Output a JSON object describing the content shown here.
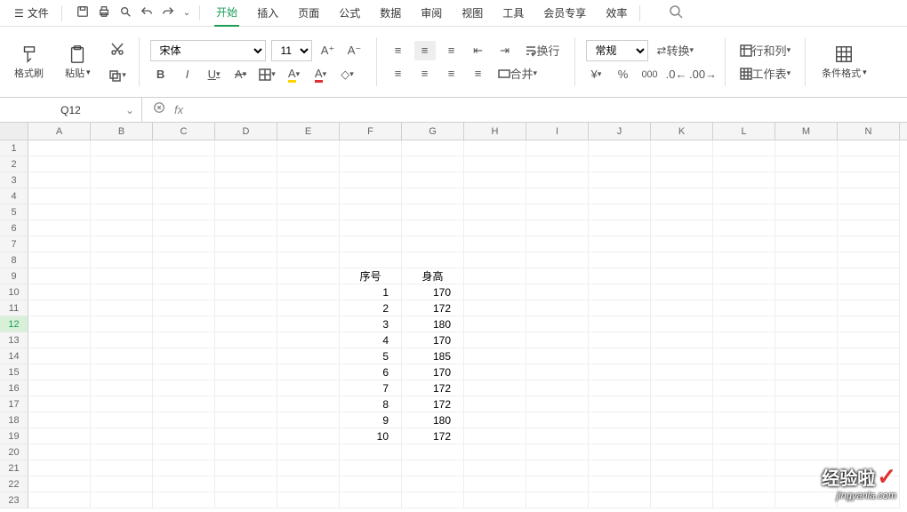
{
  "menu": {
    "file": "文件",
    "tabs": [
      "开始",
      "插入",
      "页面",
      "公式",
      "数据",
      "审阅",
      "视图",
      "工具",
      "会员专享",
      "效率"
    ],
    "active_tab": 0
  },
  "toolbar": {
    "brush": "格式刷",
    "paste": "粘贴",
    "font_name": "宋体",
    "font_size": "11",
    "wrap": "换行",
    "merge": "合并",
    "num_format": "常规",
    "convert": "转换",
    "rowcol": "行和列",
    "worksheet": "工作表",
    "cond_format": "条件格式"
  },
  "cell_ref": "Q12",
  "columns": [
    "A",
    "B",
    "C",
    "D",
    "E",
    "F",
    "G",
    "H",
    "I",
    "J",
    "K",
    "L",
    "M",
    "N"
  ],
  "row_count": 23,
  "selected_row": 12,
  "data": {
    "F9": "序号",
    "G9": "身高",
    "F10": "1",
    "G10": "170",
    "F11": "2",
    "G11": "172",
    "F12": "3",
    "G12": "180",
    "F13": "4",
    "G13": "170",
    "F14": "5",
    "G14": "185",
    "F15": "6",
    "G15": "170",
    "F16": "7",
    "G16": "172",
    "F17": "8",
    "G17": "172",
    "F18": "9",
    "G18": "180",
    "F19": "10",
    "G19": "172"
  },
  "watermark": {
    "zh": "经验啦",
    "check": "✓",
    "en": "jingyanla.com"
  }
}
